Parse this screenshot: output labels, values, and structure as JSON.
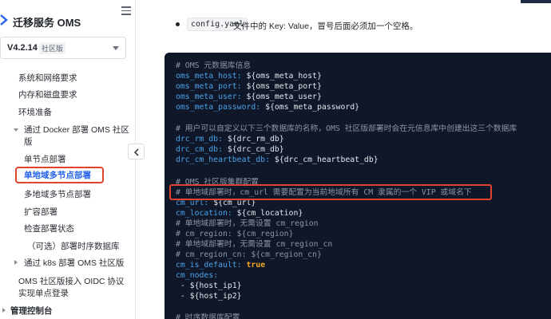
{
  "sidebar": {
    "brand_title": "迁移服务 OMS",
    "version": {
      "number": "V4.2.14",
      "badge": "社区版"
    },
    "items": [
      {
        "label": "系统和网络要求"
      },
      {
        "label": "内存和磁盘要求"
      },
      {
        "label": "环境准备"
      },
      {
        "label": "通过 Docker 部署 OMS 社区",
        "label2": "版"
      },
      {
        "label": "单节点部署"
      },
      {
        "label": "单地域多节点部署"
      },
      {
        "label": "多地域多节点部署"
      },
      {
        "label": "扩容部署"
      },
      {
        "label": "检查部署状态"
      },
      {
        "label": "（可选）部署时序数据库"
      },
      {
        "label": "通过 k8s 部署 OMS 社区版"
      },
      {
        "label": "OMS 社区版接入 OIDC 协议",
        "label2": "实现单点登录"
      },
      {
        "label": "管理控制台"
      }
    ]
  },
  "content": {
    "bullet_code": "config.yaml",
    "bullet_text": "文件中的 Key: Value，冒号后面必须加一个空格。"
  },
  "code": {
    "l1": "# OMS 元数据库信息",
    "l2k": "oms_meta_host:",
    "l2v": " ${oms_meta_host}",
    "l3k": "oms_meta_port:",
    "l3v": " ${oms_meta_port}",
    "l4k": "oms_meta_user:",
    "l4v": " ${oms_meta_user}",
    "l5k": "oms_meta_password:",
    "l5v": " ${oms_meta_password}",
    "l6": "# 用户可以自定义以下三个数据库的名称，OMS 社区版部署时会在元信息库中创建出这三个数据库",
    "l7k": "drc_rm_db:",
    "l7v": " ${drc_rm_db}",
    "l8k": "drc_cm_db:",
    "l8v": " ${drc_cm_db}",
    "l9k": "drc_cm_heartbeat_db:",
    "l9v": " ${drc_cm_heartbeat_db}",
    "l10": "# OMS 社区版集群配置",
    "l11": "# 单地域部署时，cm_url 需要配置为当前地域所有 CM 隶属的一个 VIP 或域名下",
    "l12k": "cm_url:",
    "l12v": " ${cm_url}",
    "l13k": "cm_location:",
    "l13v": " ${cm_location}",
    "l14": "# 单地域部署时，无需设置 cm_region",
    "l15": "# cm_region: ${cm_region}",
    "l16": "# 单地域部署时，无需设置 cm_region_cn",
    "l17": "# cm_region_cn: ${cm_region_cn}",
    "l18k": "cm_is_default:",
    "l18v": "true",
    "l19k": "cm_nodes:",
    "l20": " - ${host_ip1}",
    "l21": " - ${host_ip2}",
    "l22": "# 时序数据库配置"
  }
}
